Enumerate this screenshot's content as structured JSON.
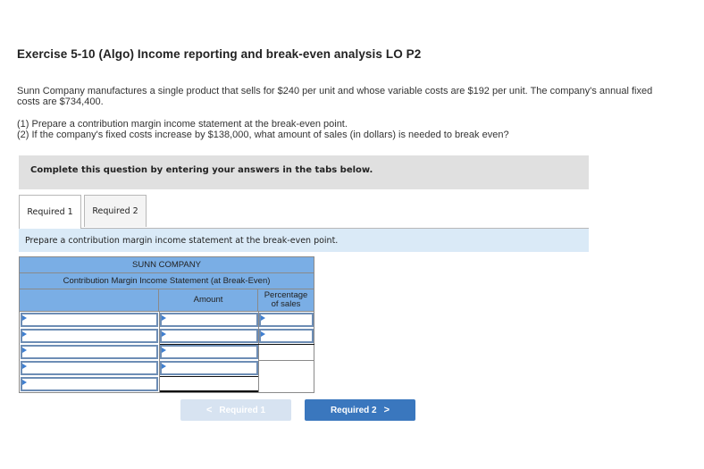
{
  "exercise": {
    "title": "Exercise 5-10 (Algo) Income reporting and break-even analysis LO P2",
    "description": "Sunn Company manufactures a single product that sells for $240 per unit and whose variable costs are $192 per unit. The company's annual fixed costs are $734,400.",
    "questions": [
      "(1) Prepare a contribution margin income statement at the break-even point.",
      "(2) If the company's fixed costs increase by $138,000, what amount of sales (in dollars) is needed to break even?"
    ]
  },
  "banner": {
    "text": "Complete this question by entering your answers in the tabs below."
  },
  "tabs": [
    {
      "label": "Required 1",
      "active": true
    },
    {
      "label": "Required 2",
      "active": false
    }
  ],
  "instruction": "Prepare a contribution margin income statement at the break-even point.",
  "statement": {
    "company": "SUNN COMPANY",
    "title": "Contribution Margin Income Statement (at Break-Even)",
    "columns": {
      "label": "",
      "amount": "Amount",
      "percentage": "Percentage of sales"
    },
    "percentage_line1": "Percentage",
    "percentage_line2": "of sales",
    "rows": [
      {
        "label": "",
        "amount": "",
        "percentage": ""
      },
      {
        "label": "",
        "amount": "",
        "percentage": ""
      },
      {
        "label": "",
        "amount": ""
      },
      {
        "label": "",
        "amount": ""
      },
      {
        "label": "",
        "amount": ""
      }
    ]
  },
  "navigation": {
    "prev_label": "Required 1",
    "next_label": "Required 2",
    "prev_icon": "chevron-left-icon",
    "next_icon": "chevron-right-icon"
  },
  "colors": {
    "header_blue": "#7aaee5",
    "instruction_bg": "#daeaf7",
    "banner_bg": "#e0e0e0",
    "next_button": "#3a77be",
    "prev_button_disabled": "#d7e3f1"
  }
}
